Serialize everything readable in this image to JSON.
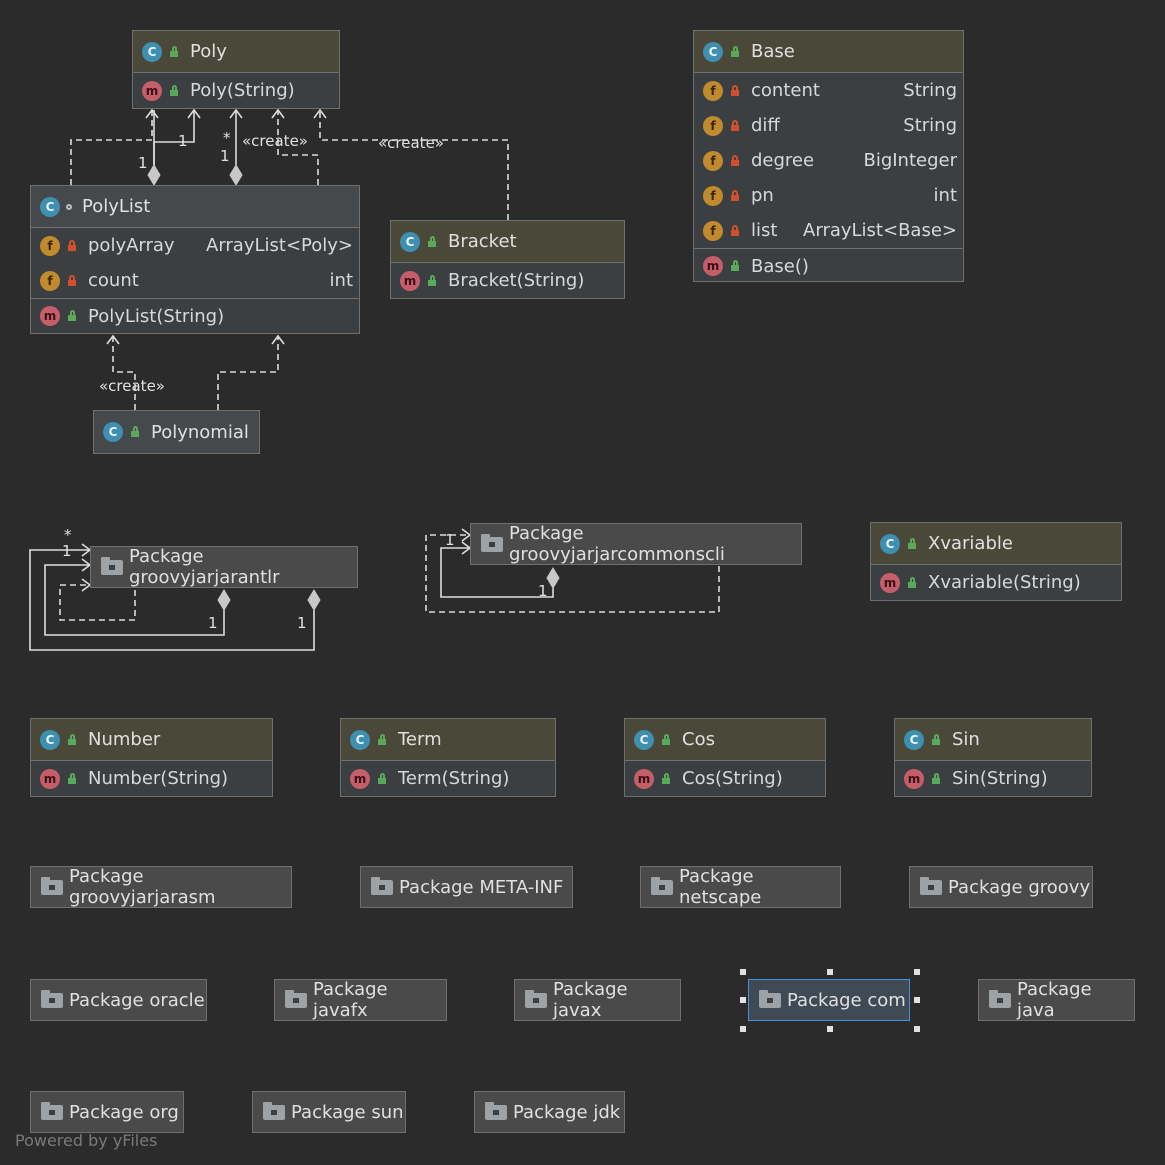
{
  "classes": {
    "poly": {
      "name": "Poly",
      "methods": [
        {
          "name": "Poly(String)"
        }
      ]
    },
    "base": {
      "name": "Base",
      "fields": [
        {
          "name": "content",
          "type": "String"
        },
        {
          "name": "diff",
          "type": "String"
        },
        {
          "name": "degree",
          "type": "BigInteger"
        },
        {
          "name": "pn",
          "type": "int"
        },
        {
          "name": "list",
          "type": "ArrayList<Base>"
        }
      ],
      "methods": [
        {
          "name": "Base()"
        }
      ]
    },
    "polylist": {
      "name": "PolyList",
      "fields": [
        {
          "name": "polyArray",
          "type": "ArrayList<Poly>"
        },
        {
          "name": "count",
          "type": "int"
        }
      ],
      "methods": [
        {
          "name": "PolyList(String)"
        }
      ]
    },
    "bracket": {
      "name": "Bracket",
      "methods": [
        {
          "name": "Bracket(String)"
        }
      ]
    },
    "polynomial": {
      "name": "Polynomial"
    },
    "xvariable": {
      "name": "Xvariable",
      "methods": [
        {
          "name": "Xvariable(String)"
        }
      ]
    },
    "number": {
      "name": "Number",
      "methods": [
        {
          "name": "Number(String)"
        }
      ]
    },
    "term": {
      "name": "Term",
      "methods": [
        {
          "name": "Term(String)"
        }
      ]
    },
    "cos": {
      "name": "Cos",
      "methods": [
        {
          "name": "Cos(String)"
        }
      ]
    },
    "sin": {
      "name": "Sin",
      "methods": [
        {
          "name": "Sin(String)"
        }
      ]
    }
  },
  "icons": {
    "class": "C",
    "method": "m",
    "field": "f"
  },
  "packages": {
    "groovyjarjarantlr": "Package groovyjarjarantlr",
    "groovyjarjarcommonscli": "Package groovyjarjarcommonscli",
    "groovyjarjarasm": "Package groovyjarjarasm",
    "metainf": "Package META-INF",
    "netscape": "Package netscape",
    "groovy": "Package groovy",
    "oracle": "Package oracle",
    "javafx": "Package javafx",
    "javax": "Package javax",
    "com": "Package com",
    "java": "Package java",
    "org": "Package org",
    "sun": "Package sun",
    "jdk": "Package jdk"
  },
  "edge_labels": {
    "create": "«create»",
    "one": "1",
    "many": "*"
  },
  "footer": "Powered by yFiles",
  "colors": {
    "background": "#2b2b2b",
    "selection": "#4a8ee0"
  }
}
